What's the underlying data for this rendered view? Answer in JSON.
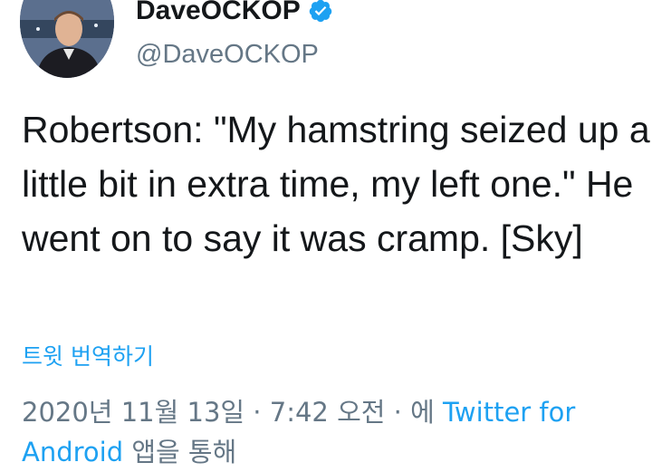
{
  "author": {
    "display_name": "DaveOCKOP",
    "handle": "@DaveOCKOP",
    "avatar_icon": "user-avatar-photo",
    "verified_icon": "verified-badge-icon"
  },
  "tweet": {
    "text": "Robertson: \"My hamstring seized up a little bit in extra time, my left one.\" He went on to say it was cramp. [Sky]",
    "translate_label": "트윗 번역하기"
  },
  "meta": {
    "date": "2020년 11월 13일",
    "separator1": " · ",
    "time": "7:42 오전",
    "separator2": " · ",
    "via_prefix": "에 ",
    "source": "Twitter for Android",
    "via_suffix": " 앱을 통해"
  },
  "colors": {
    "accent": "#1da1f2",
    "muted": "#657786",
    "text": "#14171a"
  }
}
